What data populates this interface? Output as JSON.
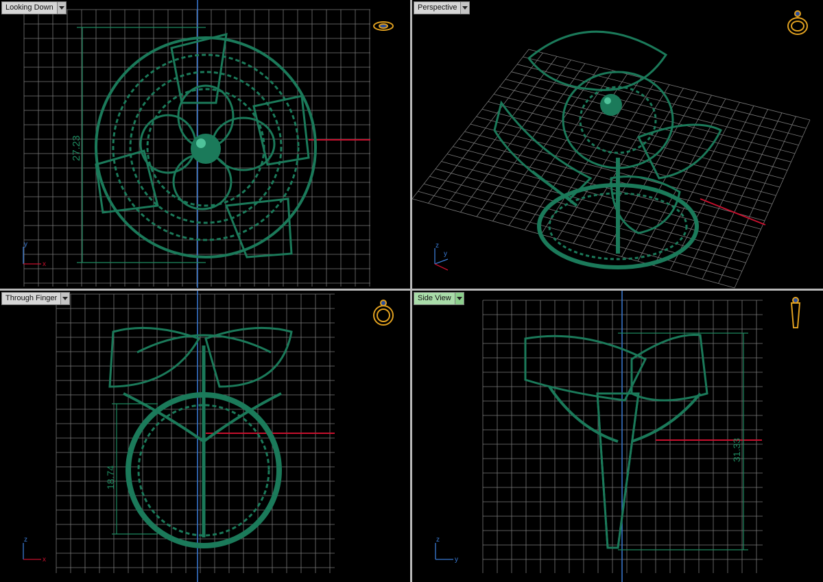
{
  "viewports": [
    {
      "label": "Looking Down",
      "active": false,
      "dimension": "27.23",
      "axes": {
        "vertical": "y",
        "horizontal": "x"
      }
    },
    {
      "label": "Perspective",
      "active": false,
      "axes": {
        "vertical": "z",
        "horizontal": "y"
      }
    },
    {
      "label": "Through Finger",
      "active": false,
      "dimension": "18.74",
      "axes": {
        "vertical": "z",
        "horizontal": "x"
      }
    },
    {
      "label": "Side View",
      "active": true,
      "dimension": "31.33",
      "axes": {
        "vertical": "z",
        "horizontal": "y"
      }
    }
  ],
  "colors": {
    "background": "#000000",
    "grid": "#8a8a8a",
    "model": "#1b7a5a",
    "dimension": "#1e8a60",
    "axis_red": "#c8102e",
    "axis_blue": "#3a7bd5",
    "widget": "#e0a020"
  },
  "icons": [
    "ring-view-top-icon",
    "ring-view-perspective-icon",
    "ring-view-front-icon",
    "ring-view-side-icon"
  ]
}
